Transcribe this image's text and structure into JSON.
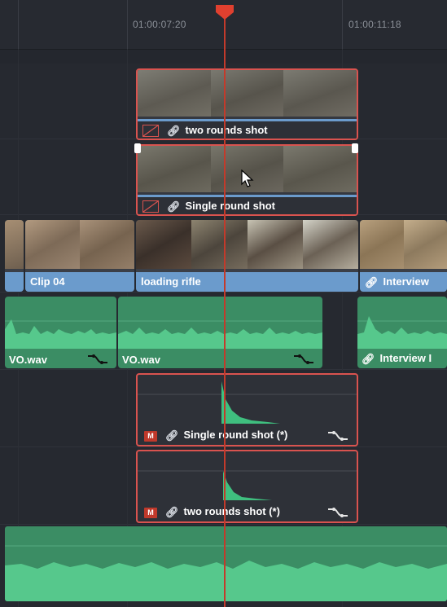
{
  "ruler": {
    "timecode_left": "01:00:07:20",
    "timecode_right": "01:00:11:18"
  },
  "video_clips": [
    {
      "name": "Clip 04",
      "selected": false,
      "linked": false
    },
    {
      "name": "loading rifle",
      "selected": false,
      "linked": false
    },
    {
      "name": "Interview",
      "selected": false,
      "linked": true
    },
    {
      "name": "two rounds shot",
      "selected": true,
      "linked": true
    },
    {
      "name": "Single round shot",
      "selected": true,
      "linked": true
    }
  ],
  "audio_clips": [
    {
      "name": "VO.wav",
      "selected": false
    },
    {
      "name": "VO.wav",
      "selected": false
    },
    {
      "name": "Interview I",
      "selected": false,
      "linked": true
    },
    {
      "name": "Single round shot (*)",
      "selected": true,
      "linked": true,
      "badge": "M"
    },
    {
      "name": "two rounds shot (*)",
      "selected": true,
      "linked": true,
      "badge": "M"
    }
  ],
  "colors": {
    "video_clip": "#6b9bcc",
    "audio_clip": "#3b8d64",
    "selection": "#d9534f",
    "playhead": "#c33a2b",
    "background": "#24272e"
  },
  "icons": {
    "playhead": "playhead-marker-icon",
    "link": "link-icon",
    "curve": "volume-curve-icon",
    "no-flag": "disabled-flag-icon",
    "cursor": "mouse-pointer-icon",
    "mute": "mute-badge-icon"
  }
}
